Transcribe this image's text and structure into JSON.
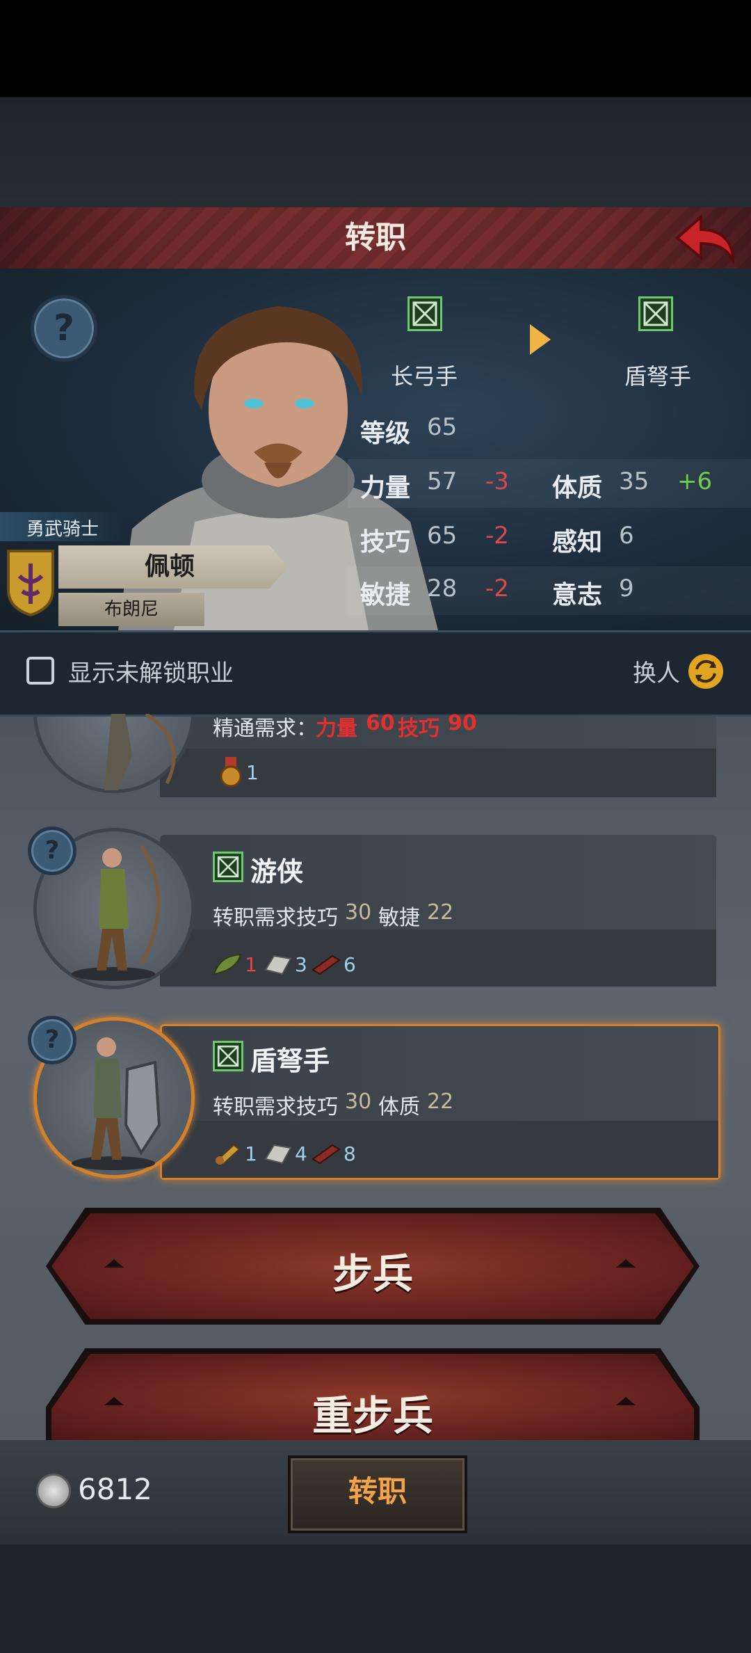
{
  "header": {
    "title": "转职",
    "from_class": "长弓手",
    "to_class": "盾弩手",
    "level_label": "等级",
    "level_value": "65",
    "stats": [
      {
        "key": "力量",
        "value": "57",
        "delta": "-3"
      },
      {
        "key": "体质",
        "value": "35",
        "delta": "+6"
      },
      {
        "key": "技巧",
        "value": "65",
        "delta": "-2"
      },
      {
        "key": "感知",
        "value": "6",
        "delta": ""
      },
      {
        "key": "敏捷",
        "value": "28",
        "delta": "-2"
      },
      {
        "key": "意志",
        "value": "9",
        "delta": ""
      }
    ]
  },
  "character": {
    "title": "勇武骑士",
    "name": "佩顿",
    "subname": "布朗尼"
  },
  "toolbar": {
    "show_locked_label": "显示未解锁职业",
    "swap_label": "换人"
  },
  "classes": [
    {
      "name": "",
      "req_label": "精通需求：",
      "req_items": [
        {
          "stat": "力量",
          "value": "60",
          "color": "red"
        },
        {
          "stat": "技巧",
          "value": "90",
          "color": "red"
        }
      ],
      "costs": [
        {
          "icon": "medal-icon",
          "count": "1",
          "color": "blue"
        }
      ]
    },
    {
      "name": "游侠",
      "req_label": "转职需求",
      "req_items": [
        {
          "stat": "技巧",
          "value": "30"
        },
        {
          "stat": "敏捷",
          "value": "22"
        }
      ],
      "costs": [
        {
          "icon": "leaf-icon",
          "count": "1",
          "color": "red"
        },
        {
          "icon": "iron-ingot-icon",
          "count": "3",
          "color": "blue"
        },
        {
          "icon": "wood-plank-icon",
          "count": "6",
          "color": "blue"
        }
      ]
    },
    {
      "name": "盾弩手",
      "req_label": "转职需求",
      "req_items": [
        {
          "stat": "技巧",
          "value": "30"
        },
        {
          "stat": "体质",
          "value": "22"
        }
      ],
      "costs": [
        {
          "icon": "scroll-icon",
          "count": "1",
          "color": "blue"
        },
        {
          "icon": "iron-ingot-icon",
          "count": "4",
          "color": "blue"
        },
        {
          "icon": "wood-plank-icon",
          "count": "8",
          "color": "blue"
        }
      ]
    }
  ],
  "categories": [
    "步兵",
    "重步兵"
  ],
  "footer": {
    "coins": "6812",
    "confirm_label": "转职"
  },
  "colors": {
    "accent": "#d5812b",
    "negative": "#d94b4b",
    "positive": "#6ccf4a",
    "title_bar": "#7a2f31"
  }
}
